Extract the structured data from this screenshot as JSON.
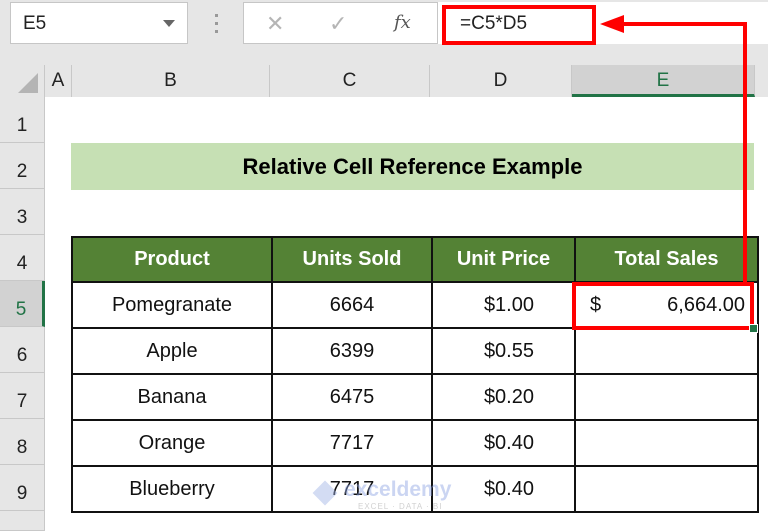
{
  "formula_bar": {
    "name_box": "E5",
    "cancel_icon": "✕",
    "enter_icon": "✓",
    "fx_label": "fx",
    "formula": "=C5*D5"
  },
  "columns": [
    "A",
    "B",
    "C",
    "D",
    "E"
  ],
  "selected_column": "E",
  "rows": [
    "1",
    "2",
    "3",
    "4",
    "5",
    "6",
    "7",
    "8",
    "9"
  ],
  "selected_row": "5",
  "sheet": {
    "title": "Relative Cell Reference Example",
    "headers": [
      "Product",
      "Units Sold",
      "Unit Price",
      "Total Sales"
    ],
    "records": [
      {
        "product": "Pomegranate",
        "units": "6664",
        "price": "$1.00",
        "total_symbol": "$",
        "total": "6,664.00"
      },
      {
        "product": "Apple",
        "units": "6399",
        "price": "$0.55",
        "total_symbol": "",
        "total": ""
      },
      {
        "product": "Banana",
        "units": "6475",
        "price": "$0.20",
        "total_symbol": "",
        "total": ""
      },
      {
        "product": "Orange",
        "units": "7717",
        "price": "$0.40",
        "total_symbol": "",
        "total": ""
      },
      {
        "product": "Blueberry",
        "units": "7717",
        "price": "$0.40",
        "total_symbol": "",
        "total": ""
      }
    ]
  },
  "watermark": {
    "name": "exceldemy",
    "tagline": "EXCEL · DATA · BI"
  },
  "colors": {
    "header_green": "#548235",
    "title_fill": "#c6e0b4",
    "highlight_red": "#ff0000",
    "selection_green": "#217346"
  }
}
